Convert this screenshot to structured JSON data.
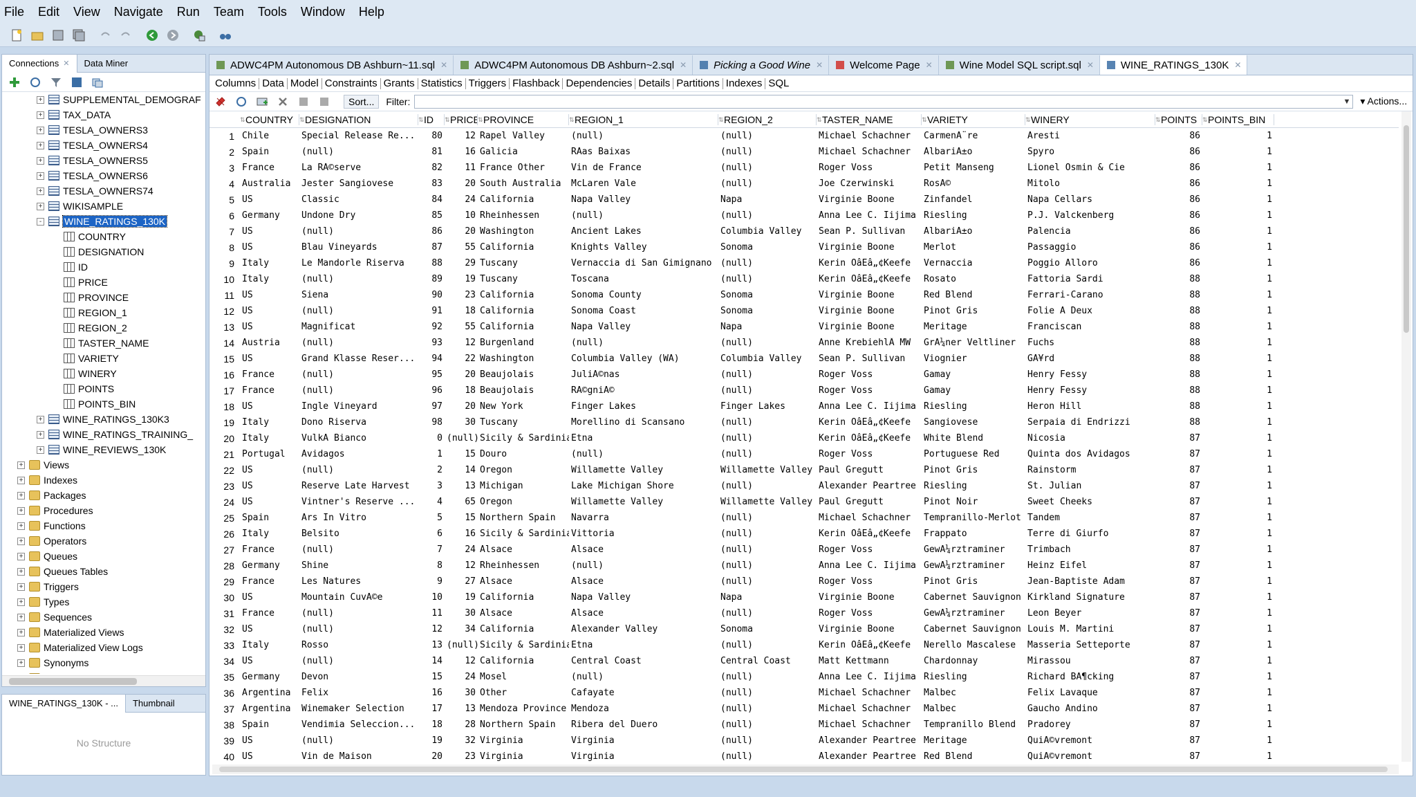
{
  "menu": [
    "File",
    "Edit",
    "View",
    "Navigate",
    "Run",
    "Team",
    "Tools",
    "Window",
    "Help"
  ],
  "left_tabs": {
    "connections": "Connections",
    "data_miner": "Data Miner"
  },
  "tree": [
    {
      "label": "SUPPLEMENTAL_DEMOGRAF",
      "kind": "table",
      "level": 2,
      "exp": "+"
    },
    {
      "label": "TAX_DATA",
      "kind": "table",
      "level": 2,
      "exp": "+"
    },
    {
      "label": "TESLA_OWNERS3",
      "kind": "table",
      "level": 2,
      "exp": "+"
    },
    {
      "label": "TESLA_OWNERS4",
      "kind": "table",
      "level": 2,
      "exp": "+"
    },
    {
      "label": "TESLA_OWNERS5",
      "kind": "table",
      "level": 2,
      "exp": "+"
    },
    {
      "label": "TESLA_OWNERS6",
      "kind": "table",
      "level": 2,
      "exp": "+"
    },
    {
      "label": "TESLA_OWNERS74",
      "kind": "table",
      "level": 2,
      "exp": "+"
    },
    {
      "label": "WIKISAMPLE",
      "kind": "table",
      "level": 2,
      "exp": "+"
    },
    {
      "label": "WINE_RATINGS_130K",
      "kind": "table",
      "level": 2,
      "exp": "-",
      "selected": true
    },
    {
      "label": "COUNTRY",
      "kind": "column",
      "level": 3
    },
    {
      "label": "DESIGNATION",
      "kind": "column",
      "level": 3
    },
    {
      "label": "ID",
      "kind": "column",
      "level": 3
    },
    {
      "label": "PRICE",
      "kind": "column",
      "level": 3
    },
    {
      "label": "PROVINCE",
      "kind": "column",
      "level": 3
    },
    {
      "label": "REGION_1",
      "kind": "column",
      "level": 3
    },
    {
      "label": "REGION_2",
      "kind": "column",
      "level": 3
    },
    {
      "label": "TASTER_NAME",
      "kind": "column",
      "level": 3
    },
    {
      "label": "VARIETY",
      "kind": "column",
      "level": 3
    },
    {
      "label": "WINERY",
      "kind": "column",
      "level": 3
    },
    {
      "label": "POINTS",
      "kind": "column",
      "level": 3
    },
    {
      "label": "POINTS_BIN",
      "kind": "column",
      "level": 3
    },
    {
      "label": "WINE_RATINGS_130K3",
      "kind": "table",
      "level": 2,
      "exp": "+"
    },
    {
      "label": "WINE_RATINGS_TRAINING_",
      "kind": "table",
      "level": 2,
      "exp": "+"
    },
    {
      "label": "WINE_REVIEWS_130K",
      "kind": "table",
      "level": 2,
      "exp": "+"
    },
    {
      "label": "Views",
      "kind": "folder",
      "level": 1,
      "exp": "+"
    },
    {
      "label": "Indexes",
      "kind": "folder",
      "level": 1,
      "exp": "+"
    },
    {
      "label": "Packages",
      "kind": "folder",
      "level": 1,
      "exp": "+"
    },
    {
      "label": "Procedures",
      "kind": "folder",
      "level": 1,
      "exp": "+"
    },
    {
      "label": "Functions",
      "kind": "folder",
      "level": 1,
      "exp": "+"
    },
    {
      "label": "Operators",
      "kind": "folder",
      "level": 1,
      "exp": "+"
    },
    {
      "label": "Queues",
      "kind": "folder",
      "level": 1,
      "exp": "+"
    },
    {
      "label": "Queues Tables",
      "kind": "folder",
      "level": 1,
      "exp": "+"
    },
    {
      "label": "Triggers",
      "kind": "folder",
      "level": 1,
      "exp": "+"
    },
    {
      "label": "Types",
      "kind": "folder",
      "level": 1,
      "exp": "+"
    },
    {
      "label": "Sequences",
      "kind": "folder",
      "level": 1,
      "exp": "+"
    },
    {
      "label": "Materialized Views",
      "kind": "folder",
      "level": 1,
      "exp": "+"
    },
    {
      "label": "Materialized View Logs",
      "kind": "folder",
      "level": 1,
      "exp": "+"
    },
    {
      "label": "Synonyms",
      "kind": "folder",
      "level": 1,
      "exp": "+"
    },
    {
      "label": "Public Synonyms",
      "kind": "folder",
      "level": 1,
      "exp": "+"
    }
  ],
  "structure": {
    "tab1": "WINE_RATINGS_130K - ...",
    "tab2": "Thumbnail",
    "empty": "No Structure"
  },
  "doc_tabs": [
    {
      "label": "ADWC4PM Autonomous DB Ashburn~11.sql",
      "italic": false,
      "icon": "sql"
    },
    {
      "label": "ADWC4PM Autonomous DB Ashburn~2.sql",
      "italic": false,
      "icon": "sql"
    },
    {
      "label": "Picking a Good Wine",
      "italic": true,
      "icon": "workflow"
    },
    {
      "label": "Welcome Page",
      "italic": false,
      "icon": "welcome"
    },
    {
      "label": "Wine Model SQL script.sql",
      "italic": false,
      "icon": "sql"
    },
    {
      "label": "WINE_RATINGS_130K",
      "italic": false,
      "icon": "table",
      "active": true
    }
  ],
  "sub_tabs": [
    "Columns",
    "Data",
    "Model",
    "Constraints",
    "Grants",
    "Statistics",
    "Triggers",
    "Flashback",
    "Dependencies",
    "Details",
    "Partitions",
    "Indexes",
    "SQL"
  ],
  "data_toolbar": {
    "sort": "Sort...",
    "filter_label": "Filter:",
    "filter_value": "",
    "actions": "Actions..."
  },
  "grid": {
    "columns": [
      "COUNTRY",
      "DESIGNATION",
      "ID",
      "PRICE",
      "PROVINCE",
      "REGION_1",
      "REGION_2",
      "TASTER_NAME",
      "VARIETY",
      "WINERY",
      "POINTS",
      "POINTS_BIN"
    ],
    "rows": [
      [
        "1",
        "Chile",
        "Special Release Re...",
        "80",
        "12",
        "Rapel Valley",
        "(null)",
        "(null)",
        "Michael Schachner",
        "CarmenÃ¨re",
        "Aresti",
        "86",
        "1"
      ],
      [
        "2",
        "Spain",
        "(null)",
        "81",
        "16",
        "Galicia",
        "RÃ­as Baixas",
        "(null)",
        "Michael Schachner",
        "AlbariÃ±o",
        "Spyro",
        "86",
        "1"
      ],
      [
        "3",
        "France",
        "La RÃ©serve",
        "82",
        "11",
        "France Other",
        "Vin de France",
        "(null)",
        "Roger Voss",
        "Petit Manseng",
        "Lionel Osmin & Cie",
        "86",
        "1"
      ],
      [
        "4",
        "Australia",
        "Jester Sangiovese",
        "83",
        "20",
        "South Australia",
        "McLaren Vale",
        "(null)",
        "Joe Czerwinski",
        "RosÃ©",
        "Mitolo",
        "86",
        "1"
      ],
      [
        "5",
        "US",
        "Classic",
        "84",
        "24",
        "California",
        "Napa Valley",
        "Napa",
        "Virginie Boone",
        "Zinfandel",
        "Napa Cellars",
        "86",
        "1"
      ],
      [
        "6",
        "Germany",
        "Undone Dry",
        "85",
        "10",
        "Rheinhessen",
        "(null)",
        "(null)",
        "Anna Lee C. Iijima",
        "Riesling",
        "P.J. Valckenberg",
        "86",
        "1"
      ],
      [
        "7",
        "US",
        "(null)",
        "86",
        "20",
        "Washington",
        "Ancient Lakes",
        "Columbia Valley",
        "Sean P. Sullivan",
        "AlbariÃ±o",
        "Palencia",
        "86",
        "1"
      ],
      [
        "8",
        "US",
        "Blau Vineyards",
        "87",
        "55",
        "California",
        "Knights Valley",
        "Sonoma",
        "Virginie Boone",
        "Merlot",
        "Passaggio",
        "86",
        "1"
      ],
      [
        "9",
        "Italy",
        "Le Mandorle Riserva",
        "88",
        "29",
        "Tuscany",
        "Vernaccia di San Gimignano",
        "(null)",
        "Kerin OâEâ„¢Keefe",
        "Vernaccia",
        "Poggio Alloro",
        "86",
        "1"
      ],
      [
        "10",
        "Italy",
        "(null)",
        "89",
        "19",
        "Tuscany",
        "Toscana",
        "(null)",
        "Kerin OâEâ„¢Keefe",
        "Rosato",
        "Fattoria Sardi",
        "88",
        "1"
      ],
      [
        "11",
        "US",
        "Siena",
        "90",
        "23",
        "California",
        "Sonoma County",
        "Sonoma",
        "Virginie Boone",
        "Red Blend",
        "Ferrari-Carano",
        "88",
        "1"
      ],
      [
        "12",
        "US",
        "(null)",
        "91",
        "18",
        "California",
        "Sonoma Coast",
        "Sonoma",
        "Virginie Boone",
        "Pinot Gris",
        "Folie Ã  Deux",
        "88",
        "1"
      ],
      [
        "13",
        "US",
        "Magnificat",
        "92",
        "55",
        "California",
        "Napa Valley",
        "Napa",
        "Virginie Boone",
        "Meritage",
        "Franciscan",
        "88",
        "1"
      ],
      [
        "14",
        "Austria",
        "(null)",
        "93",
        "12",
        "Burgenland",
        "(null)",
        "(null)",
        "Anne KrebiehlÂ MW",
        "GrÃ¼ner Veltliner",
        "Fuchs",
        "88",
        "1"
      ],
      [
        "15",
        "US",
        "Grand Klasse Reser...",
        "94",
        "22",
        "Washington",
        "Columbia Valley (WA)",
        "Columbia Valley",
        "Sean P. Sullivan",
        "Viognier",
        "GÃ¥rd",
        "88",
        "1"
      ],
      [
        "16",
        "France",
        "(null)",
        "95",
        "20",
        "Beaujolais",
        "JuliÃ©nas",
        "(null)",
        "Roger Voss",
        "Gamay",
        "Henry Fessy",
        "88",
        "1"
      ],
      [
        "17",
        "France",
        "(null)",
        "96",
        "18",
        "Beaujolais",
        "RÃ©gniÃ©",
        "(null)",
        "Roger Voss",
        "Gamay",
        "Henry Fessy",
        "88",
        "1"
      ],
      [
        "18",
        "US",
        "Ingle Vineyard",
        "97",
        "20",
        "New York",
        "Finger Lakes",
        "Finger Lakes",
        "Anna Lee C. Iijima",
        "Riesling",
        "Heron Hill",
        "88",
        "1"
      ],
      [
        "19",
        "Italy",
        "Dono Riserva",
        "98",
        "30",
        "Tuscany",
        "Morellino di Scansano",
        "(null)",
        "Kerin OâEâ„¢Keefe",
        "Sangiovese",
        "Serpaia di Endrizzi",
        "88",
        "1"
      ],
      [
        "20",
        "Italy",
        "VulkÃ  Bianco",
        "0",
        "(null)",
        "Sicily & Sardinia",
        "Etna",
        "(null)",
        "Kerin OâEâ„¢Keefe",
        "White Blend",
        "Nicosia",
        "87",
        "1"
      ],
      [
        "21",
        "Portugal",
        "Avidagos",
        "1",
        "15",
        "Douro",
        "(null)",
        "(null)",
        "Roger Voss",
        "Portuguese Red",
        "Quinta dos Avidagos",
        "87",
        "1"
      ],
      [
        "22",
        "US",
        "(null)",
        "2",
        "14",
        "Oregon",
        "Willamette Valley",
        "Willamette Valley",
        "Paul Gregutt",
        "Pinot Gris",
        "Rainstorm",
        "87",
        "1"
      ],
      [
        "23",
        "US",
        "Reserve Late Harvest",
        "3",
        "13",
        "Michigan",
        "Lake Michigan Shore",
        "(null)",
        "Alexander Peartree",
        "Riesling",
        "St. Julian",
        "87",
        "1"
      ],
      [
        "24",
        "US",
        "Vintner's Reserve ...",
        "4",
        "65",
        "Oregon",
        "Willamette Valley",
        "Willamette Valley",
        "Paul Gregutt",
        "Pinot Noir",
        "Sweet Cheeks",
        "87",
        "1"
      ],
      [
        "25",
        "Spain",
        "Ars In Vitro",
        "5",
        "15",
        "Northern Spain",
        "Navarra",
        "(null)",
        "Michael Schachner",
        "Tempranillo-Merlot",
        "Tandem",
        "87",
        "1"
      ],
      [
        "26",
        "Italy",
        "Belsito",
        "6",
        "16",
        "Sicily & Sardinia",
        "Vittoria",
        "(null)",
        "Kerin OâEâ„¢Keefe",
        "Frappato",
        "Terre di Giurfo",
        "87",
        "1"
      ],
      [
        "27",
        "France",
        "(null)",
        "7",
        "24",
        "Alsace",
        "Alsace",
        "(null)",
        "Roger Voss",
        "GewÃ¼rztraminer",
        "Trimbach",
        "87",
        "1"
      ],
      [
        "28",
        "Germany",
        "Shine",
        "8",
        "12",
        "Rheinhessen",
        "(null)",
        "(null)",
        "Anna Lee C. Iijima",
        "GewÃ¼rztraminer",
        "Heinz Eifel",
        "87",
        "1"
      ],
      [
        "29",
        "France",
        "Les Natures",
        "9",
        "27",
        "Alsace",
        "Alsace",
        "(null)",
        "Roger Voss",
        "Pinot Gris",
        "Jean-Baptiste Adam",
        "87",
        "1"
      ],
      [
        "30",
        "US",
        "Mountain CuvÃ©e",
        "10",
        "19",
        "California",
        "Napa Valley",
        "Napa",
        "Virginie Boone",
        "Cabernet Sauvignon",
        "Kirkland Signature",
        "87",
        "1"
      ],
      [
        "31",
        "France",
        "(null)",
        "11",
        "30",
        "Alsace",
        "Alsace",
        "(null)",
        "Roger Voss",
        "GewÃ¼rztraminer",
        "Leon Beyer",
        "87",
        "1"
      ],
      [
        "32",
        "US",
        "(null)",
        "12",
        "34",
        "California",
        "Alexander Valley",
        "Sonoma",
        "Virginie Boone",
        "Cabernet Sauvignon",
        "Louis M. Martini",
        "87",
        "1"
      ],
      [
        "33",
        "Italy",
        "Rosso",
        "13",
        "(null)",
        "Sicily & Sardinia",
        "Etna",
        "(null)",
        "Kerin OâEâ„¢Keefe",
        "Nerello Mascalese",
        "Masseria Setteporte",
        "87",
        "1"
      ],
      [
        "34",
        "US",
        "(null)",
        "14",
        "12",
        "California",
        "Central Coast",
        "Central Coast",
        "Matt Kettmann",
        "Chardonnay",
        "Mirassou",
        "87",
        "1"
      ],
      [
        "35",
        "Germany",
        "Devon",
        "15",
        "24",
        "Mosel",
        "(null)",
        "(null)",
        "Anna Lee C. Iijima",
        "Riesling",
        "Richard BÃ¶cking",
        "87",
        "1"
      ],
      [
        "36",
        "Argentina",
        "Felix",
        "16",
        "30",
        "Other",
        "Cafayate",
        "(null)",
        "Michael Schachner",
        "Malbec",
        "Felix Lavaque",
        "87",
        "1"
      ],
      [
        "37",
        "Argentina",
        "Winemaker Selection",
        "17",
        "13",
        "Mendoza Province",
        "Mendoza",
        "(null)",
        "Michael Schachner",
        "Malbec",
        "Gaucho Andino",
        "87",
        "1"
      ],
      [
        "38",
        "Spain",
        "Vendimia Seleccion...",
        "18",
        "28",
        "Northern Spain",
        "Ribera del Duero",
        "(null)",
        "Michael Schachner",
        "Tempranillo Blend",
        "Pradorey",
        "87",
        "1"
      ],
      [
        "39",
        "US",
        "(null)",
        "19",
        "32",
        "Virginia",
        "Virginia",
        "(null)",
        "Alexander Peartree",
        "Meritage",
        "QuiÃ©vremont",
        "87",
        "1"
      ],
      [
        "40",
        "US",
        "Vin de Maison",
        "20",
        "23",
        "Virginia",
        "Virginia",
        "(null)",
        "Alexander Peartree",
        "Red Blend",
        "QuiÃ©vremont",
        "87",
        "1"
      ]
    ]
  }
}
